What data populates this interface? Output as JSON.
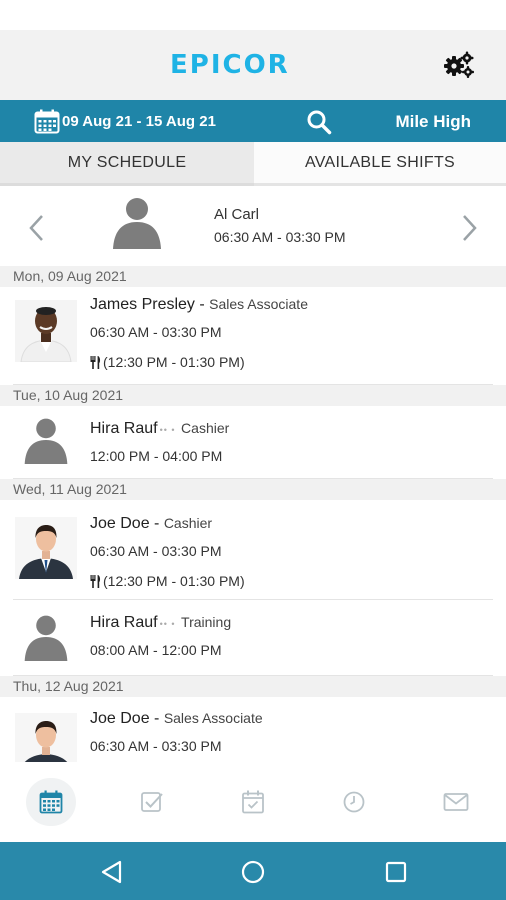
{
  "header": {
    "logo_text": "EPICOR",
    "settings_icon": "gears-icon"
  },
  "date_bar": {
    "date_range": "09 Aug 21 - 15 Aug 21",
    "store": "Mile High",
    "calendar_icon": "calendar-icon",
    "search_icon": "search-icon"
  },
  "tabs": [
    {
      "label": "MY SCHEDULE",
      "selected": true
    },
    {
      "label": "AVAILABLE SHIFTS",
      "selected": false
    }
  ],
  "profile": {
    "name": "Al Carl",
    "time": "06:30 AM - 03:30 PM"
  },
  "days": [
    {
      "header": "Mon, 09 Aug 2021",
      "shifts": [
        {
          "name": "James Presley",
          "separator": " - ",
          "role": "Sales Associate",
          "time": "06:30 AM - 03:30 PM",
          "break": "(12:30 PM - 01:30 PM)",
          "avatar": "photo"
        }
      ]
    },
    {
      "header": "Tue, 10 Aug 2021",
      "shifts": [
        {
          "name": "Hira Rauf",
          "separator": "•• • ",
          "role": "Cashier",
          "time": "12:00 PM - 04:00 PM",
          "avatar": "silhouette"
        }
      ]
    },
    {
      "header": "Wed, 11 Aug 2021",
      "shifts": [
        {
          "name": "Joe Doe",
          "separator": " - ",
          "role": "Cashier",
          "time": "06:30 AM - 03:30 PM",
          "break": "(12:30 PM - 01:30 PM)",
          "avatar": "photo"
        },
        {
          "name": "Hira Rauf",
          "separator": "•• • ",
          "role": "Training",
          "time": "08:00 AM - 12:00 PM",
          "avatar": "silhouette"
        }
      ]
    },
    {
      "header": "Thu, 12 Aug 2021",
      "shifts": [
        {
          "name": "Joe Doe",
          "separator": " - ",
          "role": "Sales Associate",
          "time": "06:30 AM - 03:30 PM",
          "avatar": "photo"
        }
      ]
    }
  ],
  "bottom_nav": [
    {
      "icon": "calendar-icon",
      "active": true
    },
    {
      "icon": "checkbox-icon",
      "active": false
    },
    {
      "icon": "calendar-check-icon",
      "active": false
    },
    {
      "icon": "clock-icon",
      "active": false
    },
    {
      "icon": "mail-icon",
      "active": false
    }
  ],
  "system_nav": [
    "back-icon",
    "home-icon",
    "recents-icon"
  ],
  "colors": {
    "accent_bar": "#1f85a8",
    "logo": "#1fb3e5",
    "system_nav": "#2989aa",
    "nav_icon": "#b9c3c8",
    "nav_icon_active": "#1f85a8"
  }
}
